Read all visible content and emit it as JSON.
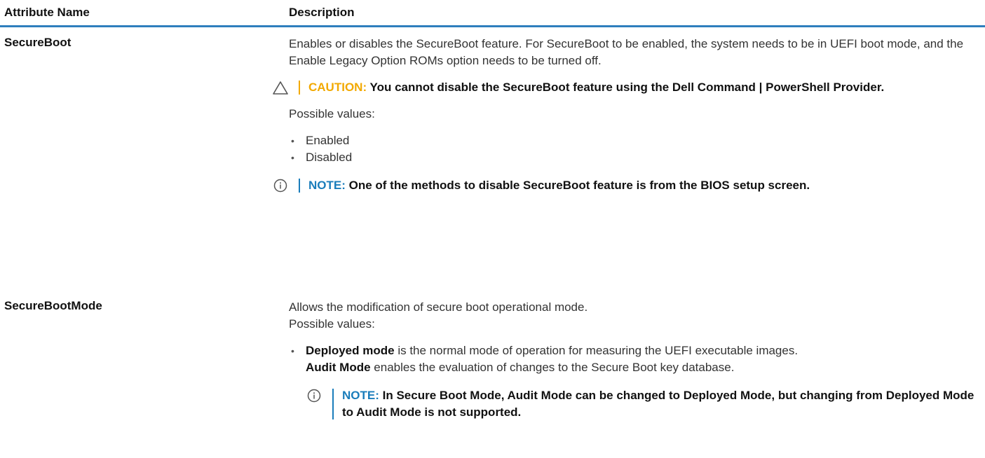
{
  "header": {
    "col_name": "Attribute Name",
    "col_desc": "Description"
  },
  "rows": [
    {
      "name": "SecureBoot",
      "desc1": "Enables or disables the SecureBoot feature. For SecureBoot to be enabled, the system needs to be in UEFI boot mode, and the Enable Legacy Option ROMs option needs to be turned off.",
      "caution_label": "CAUTION:",
      "caution_text": "You cannot disable the SecureBoot feature using the Dell Command | PowerShell Provider.",
      "possible": "Possible values:",
      "values": [
        "Enabled",
        "Disabled"
      ],
      "note_label": "NOTE:",
      "note_text": "One of the methods to disable SecureBoot feature is from the BIOS setup screen."
    },
    {
      "name": "SecureBootMode",
      "desc1": "Allows the modification of secure boot operational mode.",
      "possible": "Possible values:",
      "deployed_term": "Deployed mode",
      "deployed_text": "is the normal mode of operation for measuring the UEFI executable images.",
      "audit_term": "Audit Mode",
      "audit_text": "enables the evaluation of changes to the Secure Boot key database.",
      "note_label": "NOTE:",
      "note_text": "In Secure Boot Mode, Audit Mode can be changed to Deployed Mode, but changing from Deployed Mode to Audit Mode is not supported."
    }
  ],
  "icons": {
    "caution": "caution-triangle-icon",
    "note": "info-circle-icon"
  },
  "colors": {
    "header_rule": "#2f7fbd",
    "caution": "#f2a900",
    "note": "#1a7dbb"
  }
}
